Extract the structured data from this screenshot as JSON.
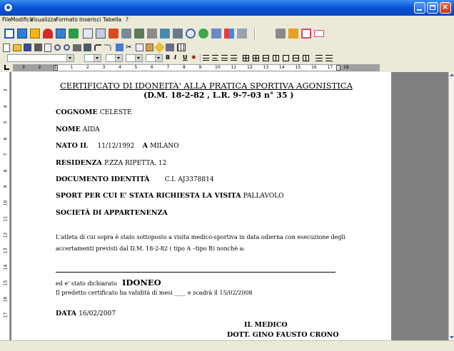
{
  "menubar": {
    "items": [
      "File",
      "Modifica",
      "Visualizza",
      "Formato",
      "Inserisci",
      "Tabella",
      "?"
    ]
  },
  "format_toolbar": {
    "bold": "B",
    "italic": "I",
    "underline": "U"
  },
  "ruler": {
    "numbers": [
      "3",
      "2",
      "1",
      "1",
      "2",
      "3",
      "4",
      "5",
      "6",
      "7",
      "8",
      "9",
      "10",
      "11",
      "12",
      "13",
      "14",
      "15",
      "16",
      "17",
      "18"
    ]
  },
  "vertical_ruler": {
    "numbers": [
      "3",
      "4",
      "5",
      "6",
      "7",
      "8",
      "9",
      "10",
      "11",
      "12",
      "13",
      "14",
      "15",
      "16",
      "17"
    ]
  },
  "document": {
    "title": "CERTIFICATO DI  IDONEITA' ALLA PRATICA SPORTIVA AGONISTICA",
    "subtitle": "(D.M. 18-2-82 , L.R. 9-7-03 n° 35 )",
    "cognome_label": "COGNOME",
    "cognome_value": "CELESTE",
    "nome_label": "NOME",
    "nome_value": "AIDA",
    "nato_label": "NATO IL",
    "nato_date": "11/12/1992",
    "nato_a_label": "A",
    "nato_place": "MILANO",
    "residenza_label": "RESIDENZA",
    "residenza_value": "P.ZZA RIPETTA, 12",
    "documento_label": "DOCUMENTO  IDENTITÀ",
    "documento_value": "C.I. AJ3378814",
    "sport_label": "SPORT PER CUI E' STATA RICHIESTA LA VISITA",
    "sport_value": "PALLAVOLO",
    "societa_label": "SOCIETÀ  DI APPARTENENZA",
    "paragraph_line1": "L'atleta di cui sopra  è stato sottoposto a visita medico-sportiva in data odierna con esecuzione degli",
    "paragraph_line2": "accertamenti previsti dal D.M. 18-2-82 ( tipo A –tipo B) nonchè a:",
    "dichiarato_text": "ed e' stato  dichiarato",
    "dichiarato_value": "IDONEO",
    "validita_text": "Il predetto certificato ha validità di mesi ____ e scadrà il 15/02/2008",
    "data_label": "DATA",
    "data_value": "16/02/2007",
    "medico_label": "IL  MEDICO",
    "medico_name": "DOTT. GINO FAUSTO CRONO"
  }
}
